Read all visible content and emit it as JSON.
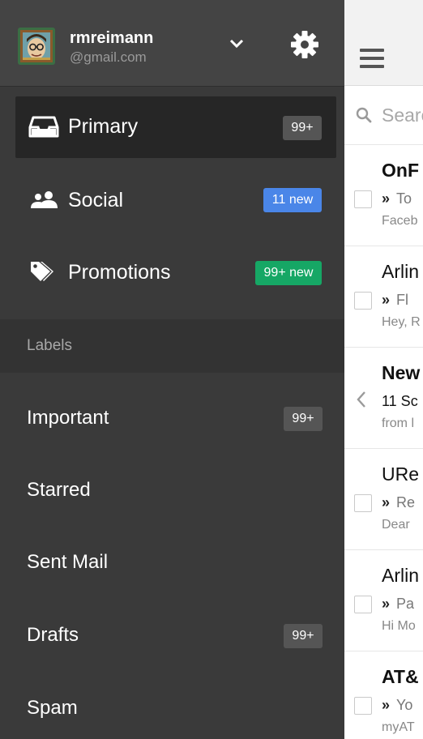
{
  "account": {
    "name": "rmreimann",
    "email": "@gmail.com"
  },
  "nav": {
    "items": [
      {
        "label": "Primary",
        "badge": "99+",
        "icon": "inbox-icon"
      },
      {
        "label": "Social",
        "badge": "11 new",
        "icon": "people-icon"
      },
      {
        "label": "Promotions",
        "badge": "99+ new",
        "icon": "tag-icon"
      }
    ]
  },
  "labels": {
    "header": "Labels",
    "items": [
      {
        "label": "Important",
        "badge": "99+"
      },
      {
        "label": "Starred",
        "badge": ""
      },
      {
        "label": "Sent Mail",
        "badge": ""
      },
      {
        "label": "Drafts",
        "badge": "99+"
      },
      {
        "label": "Spam",
        "badge": ""
      }
    ]
  },
  "mail": {
    "search_placeholder": "Search",
    "rows": [
      {
        "from": "OnF",
        "subject": "To",
        "snippet": "Faceb",
        "bold": true
      },
      {
        "from": "Arlin",
        "subject": "Fl",
        "snippet": "Hey, R",
        "bold": false
      },
      {
        "from": "New",
        "subject": "11 Sc",
        "snippet": "from l",
        "bold": true
      },
      {
        "from": "URe",
        "subject": "Re",
        "snippet": "Dear",
        "bold": false
      },
      {
        "from": "Arlin",
        "subject": "Pa",
        "snippet": "Hi Mo",
        "bold": false
      },
      {
        "from": "AT&",
        "subject": "Yo",
        "snippet": "myAT",
        "bold": true
      }
    ],
    "marker": "»"
  },
  "colors": {
    "drawer_bg": "#3a3a3a",
    "social_badge": "#4a86e8",
    "promotions_badge": "#16a765"
  }
}
